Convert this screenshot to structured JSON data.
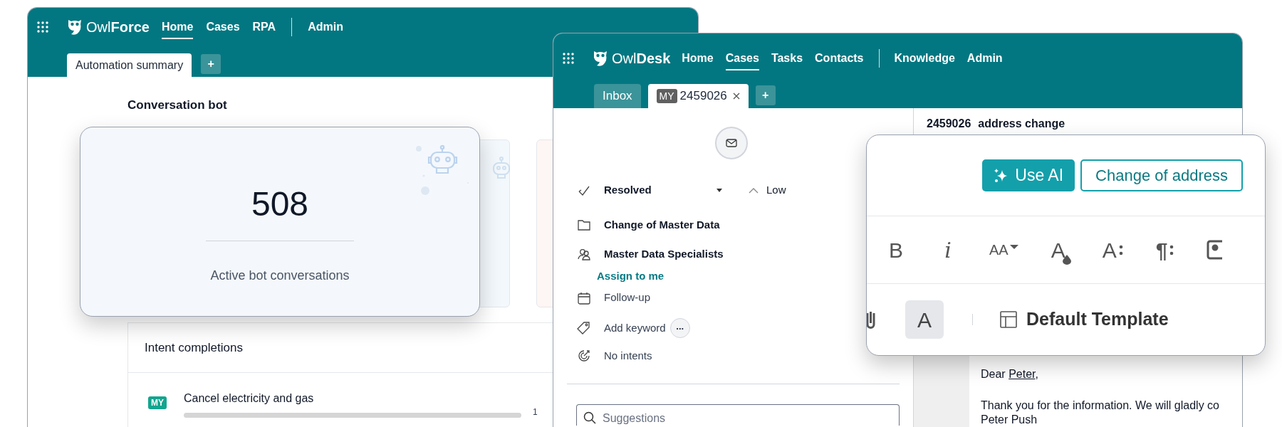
{
  "owlforce_window": {
    "brand_light": "Owl",
    "brand_bold": "Force",
    "nav_groups": [
      {
        "items": [
          {
            "label": "Home",
            "selected": true
          },
          {
            "label": "Cases",
            "selected": false
          },
          {
            "label": "RPA",
            "selected": false
          }
        ]
      },
      {
        "items": [
          {
            "label": "Admin",
            "selected": false
          }
        ]
      }
    ],
    "tabs": [
      {
        "label": "Automation summary",
        "selected": true
      }
    ],
    "add_tab": "+",
    "section_title": "Conversation bot",
    "stat_card": {
      "value": "508",
      "label": "Active bot conversations"
    },
    "intent_panel": {
      "title": "Intent completions",
      "rows": [
        {
          "badge": "MY",
          "label": "Cancel electricity and gas",
          "level": 0,
          "count": "1"
        }
      ]
    }
  },
  "owldesk_window": {
    "brand_light": "Owl",
    "brand_bold": "Desk",
    "nav_groups": [
      {
        "items": [
          {
            "label": "Home",
            "selected": false
          },
          {
            "label": "Cases",
            "selected": true
          },
          {
            "label": "Tasks",
            "selected": false
          },
          {
            "label": "Contacts",
            "selected": false
          }
        ]
      },
      {
        "items": [
          {
            "label": "Knowledge",
            "selected": false
          },
          {
            "label": "Admin",
            "selected": false
          }
        ]
      }
    ],
    "tabs": [
      {
        "label": "Inbox",
        "selected": false,
        "closable": false
      },
      {
        "badge": "MY",
        "label": "2459026",
        "selected": true,
        "closable": true
      }
    ],
    "add_tab": "+",
    "case": {
      "status": "Resolved",
      "priority": "Low",
      "category": "Change of Master Data",
      "team": "Master Data Specialists",
      "assign_link": "Assign to me",
      "follow_up": "Follow-up",
      "keyword": "Add keyword",
      "more": "...",
      "intents": "No intents",
      "search_placeholder": "Suggestions"
    },
    "email": {
      "case_id": "2459026",
      "subject": "address change",
      "greeting": "Dear",
      "name": "Peter",
      "greeting_end": ",",
      "lines": [
        "Thank you for the information. We will gladly co",
        "Peter Push"
      ]
    }
  },
  "editor_popup": {
    "ai_button": "Use AI",
    "template_chip": "Change of address",
    "toolbar": [
      {
        "kind": "bold",
        "label": "B"
      },
      {
        "kind": "italic",
        "label": "i"
      },
      {
        "kind": "font_size",
        "label": "AA"
      },
      {
        "kind": "font_color",
        "label": "A"
      },
      {
        "kind": "text_style",
        "label": "A"
      },
      {
        "kind": "paragraph",
        "label": "¶"
      },
      {
        "kind": "image"
      }
    ],
    "bottom": [
      {
        "kind": "attach"
      },
      {
        "kind": "text_format",
        "label": "A",
        "selected": true
      },
      {
        "kind": "separator"
      },
      {
        "kind": "template",
        "label": "Default Template"
      }
    ]
  }
}
